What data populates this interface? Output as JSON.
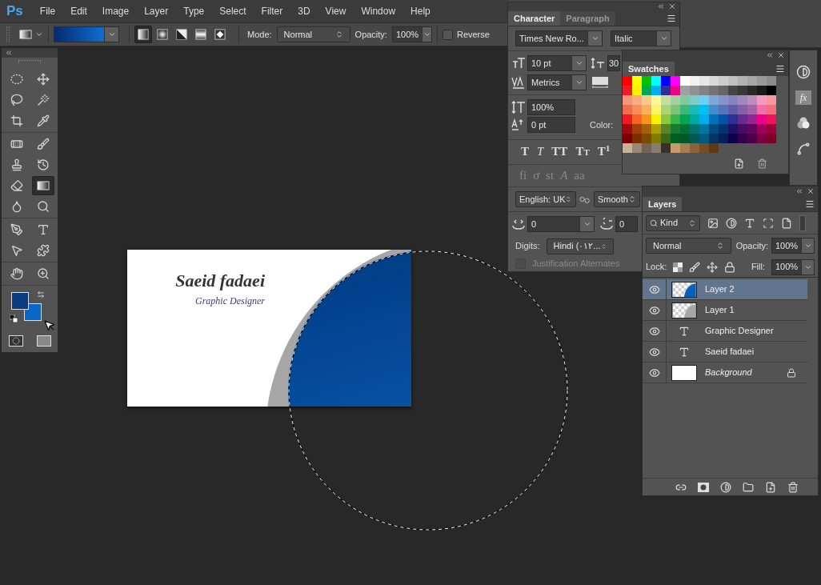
{
  "app_logo": "Ps",
  "menu": [
    "File",
    "Edit",
    "Image",
    "Layer",
    "Type",
    "Select",
    "Filter",
    "3D",
    "View",
    "Window",
    "Help"
  ],
  "options_bar": {
    "gradient_types": [
      {
        "kind": "linear",
        "selected": true
      },
      {
        "kind": "radial",
        "selected": false
      },
      {
        "kind": "angle",
        "selected": false
      },
      {
        "kind": "reflected",
        "selected": false
      },
      {
        "kind": "diamond",
        "selected": false
      }
    ],
    "mode_label": "Mode:",
    "mode": "Normal",
    "opacity_label": "Opacity:",
    "opacity": "100%",
    "reverse": {
      "label": "Reverse",
      "checked": false
    }
  },
  "tools": {
    "groups": [
      [
        {
          "kind": "marquee",
          "selected": false
        },
        {
          "kind": "move",
          "selected": false
        },
        {
          "kind": "lasso",
          "selected": false
        },
        {
          "kind": "quick_select",
          "selected": false
        },
        {
          "kind": "crop",
          "selected": false
        },
        {
          "kind": "eyedropper",
          "selected": false
        }
      ],
      [
        {
          "kind": "healing",
          "selected": false
        },
        {
          "kind": "brush",
          "selected": false
        },
        {
          "kind": "stamp",
          "selected": false
        },
        {
          "kind": "history_brush",
          "selected": false
        },
        {
          "kind": "eraser",
          "selected": false
        },
        {
          "kind": "gradient",
          "selected": true
        },
        {
          "kind": "blur",
          "selected": false
        },
        {
          "kind": "dodge",
          "selected": false
        }
      ],
      [
        {
          "kind": "pen",
          "selected": false
        },
        {
          "kind": "type",
          "selected": false
        },
        {
          "kind": "path_select",
          "selected": false
        },
        {
          "kind": "custom_shape",
          "selected": false
        }
      ],
      [
        {
          "kind": "hand",
          "selected": false
        },
        {
          "kind": "zoom",
          "selected": false
        }
      ]
    ]
  },
  "document": {
    "name": "Saeid fadaei",
    "title": "Graphic Designer"
  },
  "character_panel": {
    "tabs": [
      {
        "label": "Character",
        "selected": true
      },
      {
        "label": "Paragraph",
        "selected": false
      }
    ],
    "font_family": "Times New Ro...",
    "font_style": "Italic",
    "size": "10 pt",
    "leading": "30",
    "kerning": "Metrics",
    "vertical_scale": "100%",
    "baseline_shift": "0 pt",
    "color_label": "Color:",
    "style_buttons": [
      {
        "label": "T",
        "kind": "bold"
      },
      {
        "label": "T",
        "kind": "italic"
      },
      {
        "label": "TT",
        "kind": "caps"
      },
      {
        "label": "Tt",
        "kind": "small_caps"
      },
      {
        "label": "T$^{1}$",
        "kind": "superscript"
      }
    ],
    "opentype_buttons": [
      "fi",
      "ơ",
      "st",
      "A",
      "aa"
    ],
    "language": "English: UK",
    "antialias": "Smooth",
    "kashida_1": "0",
    "kashida_2": "0",
    "digits_label": "Digits:",
    "digits": "Hindi (٠١٢...",
    "justification_alternates": {
      "label": "Justification Alternates",
      "checked": false,
      "disabled": true
    }
  },
  "dock": {
    "styles_label": "fx"
  },
  "swatches_panel": {
    "tab": "Swatches",
    "rows": [
      {
        "swatches": [
          {
            "color": "#ff0000"
          },
          {
            "color": "#ffff00"
          },
          {
            "color": "#00c000"
          },
          {
            "color": "#00ffff"
          },
          {
            "color": "#0000ff"
          },
          {
            "color": "#ff00ff"
          },
          {
            "color": "#ffffff"
          },
          {
            "color": "#f2f2f2"
          },
          {
            "color": "#e6e6e6"
          },
          {
            "color": "#d9d9d9"
          },
          {
            "color": "#cccccc"
          },
          {
            "color": "#c0c0c0"
          },
          {
            "color": "#b3b3b3"
          },
          {
            "color": "#a6a6a6"
          },
          {
            "color": "#999999"
          },
          {
            "color": "#8c8c8c"
          }
        ]
      },
      {
        "swatches": [
          {
            "color": "#ed1c24"
          },
          {
            "color": "#fff200"
          },
          {
            "color": "#00a651"
          },
          {
            "color": "#00aeef"
          },
          {
            "color": "#2e3192"
          },
          {
            "color": "#ec008c"
          },
          {
            "color": "#a0a0a0"
          },
          {
            "color": "#919191"
          },
          {
            "color": "#828282"
          },
          {
            "color": "#737373"
          },
          {
            "color": "#666666"
          },
          {
            "color": "#454545"
          },
          {
            "color": "#383838"
          },
          {
            "color": "#2a2a2a"
          },
          {
            "color": "#1a1a1a"
          },
          {
            "color": "#000000"
          }
        ]
      },
      {
        "swatches": [
          {
            "color": "#f7977a"
          },
          {
            "color": "#f9ad81"
          },
          {
            "color": "#fdc68a"
          },
          {
            "color": "#fff79a"
          },
          {
            "color": "#c4df9b"
          },
          {
            "color": "#a2d39c"
          },
          {
            "color": "#82ca9d"
          },
          {
            "color": "#7bcdc8"
          },
          {
            "color": "#6ecff6"
          },
          {
            "color": "#7ea7d8"
          },
          {
            "color": "#8493ca"
          },
          {
            "color": "#8882be"
          },
          {
            "color": "#a187be"
          },
          {
            "color": "#bc8dbf"
          },
          {
            "color": "#f49ac2"
          },
          {
            "color": "#f6989d"
          }
        ]
      },
      {
        "swatches": [
          {
            "color": "#f26c4f"
          },
          {
            "color": "#f68e55"
          },
          {
            "color": "#fbaf5c"
          },
          {
            "color": "#fff467"
          },
          {
            "color": "#acd372"
          },
          {
            "color": "#7cc576"
          },
          {
            "color": "#3bb878"
          },
          {
            "color": "#1abbb4"
          },
          {
            "color": "#00bff3"
          },
          {
            "color": "#438ccb"
          },
          {
            "color": "#5574b9"
          },
          {
            "color": "#605ca8"
          },
          {
            "color": "#855fa8"
          },
          {
            "color": "#a763a8"
          },
          {
            "color": "#f06eaa"
          },
          {
            "color": "#f26d7d"
          }
        ]
      },
      {
        "swatches": [
          {
            "color": "#ed1c24"
          },
          {
            "color": "#f26522"
          },
          {
            "color": "#f7941d"
          },
          {
            "color": "#fff200"
          },
          {
            "color": "#8dc73f"
          },
          {
            "color": "#39b54a"
          },
          {
            "color": "#00a651"
          },
          {
            "color": "#00a99d"
          },
          {
            "color": "#00aeef"
          },
          {
            "color": "#0072bc"
          },
          {
            "color": "#0054a6"
          },
          {
            "color": "#2e3192"
          },
          {
            "color": "#662d91"
          },
          {
            "color": "#92278f"
          },
          {
            "color": "#ec008c"
          },
          {
            "color": "#ed145b"
          }
        ]
      },
      {
        "swatches": [
          {
            "color": "#9e0b0f"
          },
          {
            "color": "#a0410d"
          },
          {
            "color": "#a36209"
          },
          {
            "color": "#aba000"
          },
          {
            "color": "#598527"
          },
          {
            "color": "#1a7b30"
          },
          {
            "color": "#007236"
          },
          {
            "color": "#00746b"
          },
          {
            "color": "#0076a3"
          },
          {
            "color": "#004b80"
          },
          {
            "color": "#003471"
          },
          {
            "color": "#1b1464"
          },
          {
            "color": "#440e62"
          },
          {
            "color": "#630460"
          },
          {
            "color": "#9e005d"
          },
          {
            "color": "#9e0039"
          }
        ]
      },
      {
        "swatches": [
          {
            "color": "#790000"
          },
          {
            "color": "#7b2e00"
          },
          {
            "color": "#7d4900"
          },
          {
            "color": "#827b00"
          },
          {
            "color": "#406618"
          },
          {
            "color": "#005e20"
          },
          {
            "color": "#005826"
          },
          {
            "color": "#005952"
          },
          {
            "color": "#005b7f"
          },
          {
            "color": "#003663"
          },
          {
            "color": "#002157"
          },
          {
            "color": "#0d004c"
          },
          {
            "color": "#32004b"
          },
          {
            "color": "#4b0049"
          },
          {
            "color": "#7b0046"
          },
          {
            "color": "#7a0026"
          }
        ]
      },
      {
        "swatches": [
          {
            "color": "#c7b299"
          },
          {
            "color": "#998675"
          },
          {
            "color": "#736357"
          },
          {
            "color": "#8a7a70"
          },
          {
            "color": "#37302d"
          },
          {
            "color": "#c69c6d"
          },
          {
            "color": "#a67c52"
          },
          {
            "color": "#8c6239"
          },
          {
            "color": "#754c24"
          },
          {
            "color": "#603913"
          }
        ]
      }
    ]
  },
  "layers_panel": {
    "tab": "Layers",
    "filter": "Kind",
    "blend_mode": "Normal",
    "opacity_label": "Opacity:",
    "opacity": "100%",
    "lock_label": "Lock:",
    "fill_label": "Fill:",
    "fill": "100%",
    "layers": [
      {
        "name": "Layer 2",
        "kind": "pixel",
        "color": "#0a5fb8",
        "visible": true,
        "selected": true,
        "locked": false
      },
      {
        "name": "Layer 1",
        "kind": "pixel",
        "color": "#a6a6a6",
        "visible": true,
        "selected": false,
        "locked": false
      },
      {
        "name": "Graphic Designer",
        "kind": "text",
        "visible": true,
        "selected": false,
        "locked": false
      },
      {
        "name": "Saeid fadaei",
        "kind": "text",
        "visible": true,
        "selected": false,
        "locked": false
      },
      {
        "name": "Background",
        "kind": "background",
        "visible": true,
        "selected": false,
        "locked": true
      }
    ]
  }
}
